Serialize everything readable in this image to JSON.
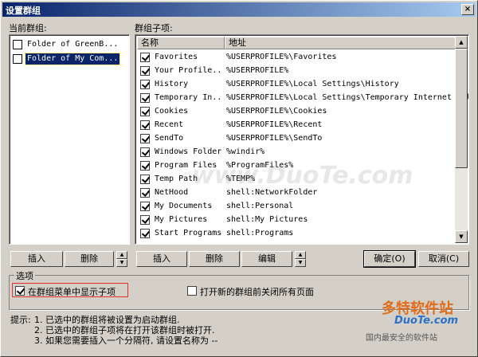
{
  "window": {
    "title": "设置群组",
    "close_glyph": "×"
  },
  "left": {
    "label": "当前群组:",
    "items": [
      {
        "label": "Folder of GreenB...",
        "selected": false
      },
      {
        "label": "Folder of My Com...",
        "selected": true
      }
    ],
    "buttons": {
      "insert": "插入",
      "delete": "删除"
    }
  },
  "right": {
    "label": "群组子项:",
    "columns": {
      "name": "名称",
      "address": "地址"
    },
    "rows": [
      {
        "name": "Favorites",
        "path": "%USERPROFILE%\\Favorites"
      },
      {
        "name": "Your Profile...",
        "path": "%USERPROFILE%"
      },
      {
        "name": "History",
        "path": "%USERPROFILE%\\Local Settings\\History"
      },
      {
        "name": "Temporary In...",
        "path": "%USERPROFILE%\\Local Settings\\Temporary Internet Files"
      },
      {
        "name": "Cookies",
        "path": "%USERPROFILE%\\Cookies"
      },
      {
        "name": "Recent",
        "path": "%USERPROFILE%\\Recent"
      },
      {
        "name": "SendTo",
        "path": "%USERPROFILE%\\SendTo"
      },
      {
        "name": "Windows Folder",
        "path": "%windir%"
      },
      {
        "name": "Program Files",
        "path": "%ProgramFiles%"
      },
      {
        "name": "Temp Path",
        "path": "%TEMP%"
      },
      {
        "name": "NetHood",
        "path": "shell:NetworkFolder"
      },
      {
        "name": "My Documents",
        "path": "shell:Personal"
      },
      {
        "name": "My Pictures",
        "path": "shell:My Pictures"
      },
      {
        "name": "Start Programs",
        "path": "shell:Programs"
      }
    ],
    "buttons": {
      "insert": "插入",
      "delete": "删除",
      "edit": "编辑"
    }
  },
  "dialog_buttons": {
    "ok": "确定(O)",
    "cancel": "取消(C)"
  },
  "options": {
    "legend": "选项",
    "show_subitems": {
      "label": "在群组菜单中显示子项",
      "checked": true
    },
    "close_all": {
      "label": "打开新的群组前关闭所有页面",
      "checked": false
    }
  },
  "tips": {
    "prefix": "提示:",
    "lines": [
      "1. 已选中的群组将被设置为启动群组.",
      "2. 已选中的群组子项将在打开该群组时被打开.",
      "3. 如果您需要插入一个分隔符, 请设置名称为 --"
    ]
  },
  "watermarks": {
    "center": "www.DuoTe.com",
    "brand": "多特软件站",
    "site": "DuoTe.com",
    "tagline": "国内最安全的软件站"
  },
  "colors": {
    "title_bar": "#0a246a",
    "selection": "#0a246a",
    "highlight_border": "#e03030"
  }
}
